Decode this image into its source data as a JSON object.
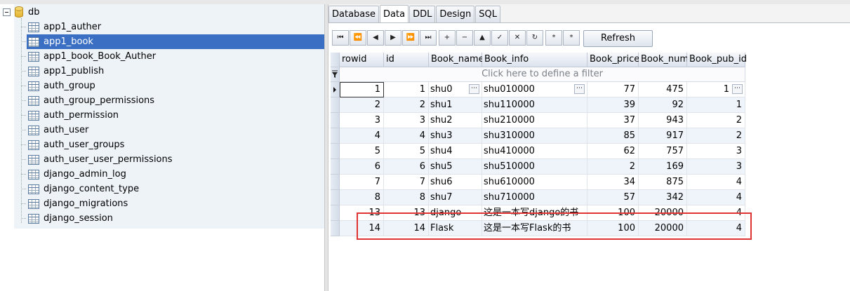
{
  "tree": {
    "root": "db",
    "tables": [
      "app1_auther",
      "app1_book",
      "app1_book_Book_Auther",
      "app1_publish",
      "auth_group",
      "auth_group_permissions",
      "auth_permission",
      "auth_user",
      "auth_user_groups",
      "auth_user_user_permissions",
      "django_admin_log",
      "django_content_type",
      "django_migrations",
      "django_session"
    ],
    "selected": "app1_book"
  },
  "tabs": [
    "Database",
    "Data",
    "DDL",
    "Design",
    "SQL"
  ],
  "active_tab": "Data",
  "toolbar": {
    "buttons": [
      "⏮",
      "⏪",
      "◀",
      "▶",
      "⏩",
      "⏭",
      "+",
      "−",
      "▲",
      "✓",
      "✕",
      "↻",
      "*",
      "*"
    ],
    "refresh_label": "Refresh"
  },
  "grid": {
    "columns": [
      "rowid",
      "id",
      "Book_name",
      "Book_info",
      "Book_price",
      "Book_num",
      "Book_pub_id"
    ],
    "filter_text": "Click here to define a filter",
    "rows": [
      [
        "1",
        "1",
        "shu0",
        "shu010000",
        "77",
        "475",
        "1"
      ],
      [
        "2",
        "2",
        "shu1",
        "shu110000",
        "39",
        "92",
        "1"
      ],
      [
        "3",
        "3",
        "shu2",
        "shu210000",
        "37",
        "943",
        "2"
      ],
      [
        "4",
        "4",
        "shu3",
        "shu310000",
        "85",
        "917",
        "2"
      ],
      [
        "5",
        "5",
        "shu4",
        "shu410000",
        "62",
        "757",
        "3"
      ],
      [
        "6",
        "6",
        "shu5",
        "shu510000",
        "2",
        "169",
        "3"
      ],
      [
        "7",
        "7",
        "shu6",
        "shu610000",
        "34",
        "875",
        "4"
      ],
      [
        "8",
        "8",
        "shu7",
        "shu710000",
        "57",
        "342",
        "4"
      ],
      [
        "13",
        "13",
        "django",
        "这是一本写django的书",
        "100",
        "20000",
        "4"
      ],
      [
        "14",
        "14",
        "Flask",
        "这是一本写Flask的书",
        "100",
        "20000",
        "4"
      ]
    ]
  },
  "colors": {
    "selection": "#3a6fc4",
    "highlight": "#e03333"
  }
}
